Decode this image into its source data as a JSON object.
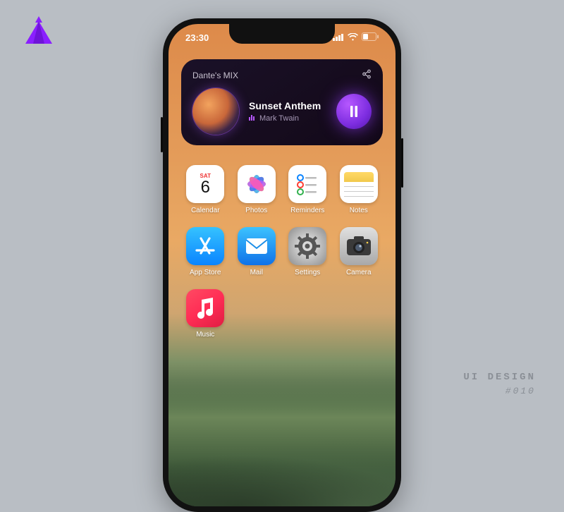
{
  "logo_color": "#8a1fff",
  "caption": {
    "line1": "UI DESIGN",
    "line2": "#010"
  },
  "statusbar": {
    "time": "23:30"
  },
  "widget": {
    "playlist": "Dante's MIX",
    "track_title": "Sunset Anthem",
    "track_artist": "Mark Twain",
    "state": "playing"
  },
  "calendar": {
    "weekday": "SAT",
    "day": "6"
  },
  "apps": [
    {
      "key": "calendar",
      "label": "Calendar"
    },
    {
      "key": "photos",
      "label": "Photos"
    },
    {
      "key": "reminders",
      "label": "Reminders"
    },
    {
      "key": "notes",
      "label": "Notes"
    },
    {
      "key": "appstore",
      "label": "App Store"
    },
    {
      "key": "mail",
      "label": "Mail"
    },
    {
      "key": "settings",
      "label": "Settings"
    },
    {
      "key": "camera",
      "label": "Camera"
    },
    {
      "key": "music",
      "label": "Music"
    }
  ]
}
